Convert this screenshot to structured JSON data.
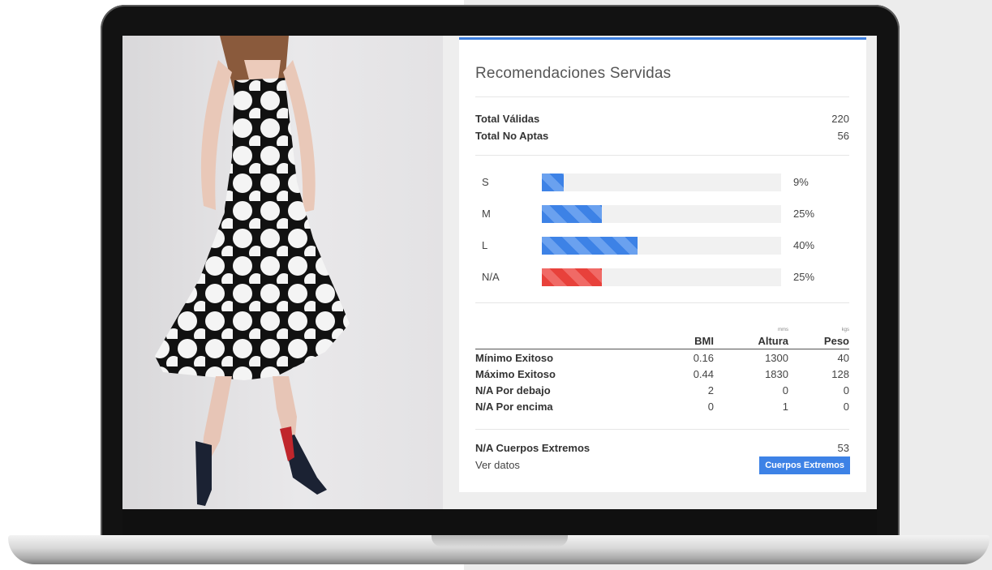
{
  "card": {
    "title": "Recomendaciones Servidas",
    "totals": [
      {
        "label": "Total Válidas",
        "value": "220"
      },
      {
        "label": "Total No Aptas",
        "value": "56"
      }
    ],
    "sizes": [
      {
        "label": "S",
        "percent": 9,
        "percent_label": "9%",
        "color": "#3d82e6"
      },
      {
        "label": "M",
        "percent": 25,
        "percent_label": "25%",
        "color": "#3d82e6"
      },
      {
        "label": "L",
        "percent": 40,
        "percent_label": "40%",
        "color": "#3d82e6"
      },
      {
        "label": "N/A",
        "percent": 25,
        "percent_label": "25%",
        "color": "#e8413b"
      }
    ],
    "table": {
      "columns": [
        {
          "label": "BMI",
          "unit": ""
        },
        {
          "label": "Altura",
          "unit": "mms"
        },
        {
          "label": "Peso",
          "unit": "kgs"
        }
      ],
      "rows": [
        {
          "label": "Mínimo Exitoso",
          "values": [
            "0.16",
            "1300",
            "40"
          ]
        },
        {
          "label": "Máximo Exitoso",
          "values": [
            "0.44",
            "1830",
            "128"
          ]
        },
        {
          "label": "N/A Por debajo",
          "values": [
            "2",
            "0",
            "0"
          ]
        },
        {
          "label": "N/A Por encima",
          "values": [
            "0",
            "1",
            "0"
          ]
        }
      ]
    },
    "extremes": {
      "label": "N/A Cuerpos Extremos",
      "value": "53"
    },
    "ver_datos": "Ver datos",
    "button_label": "Cuerpos Extremos"
  },
  "colors": {
    "accent": "#3b7ddd",
    "bar_blue": "#3d82e6",
    "bar_red": "#e8413b"
  }
}
